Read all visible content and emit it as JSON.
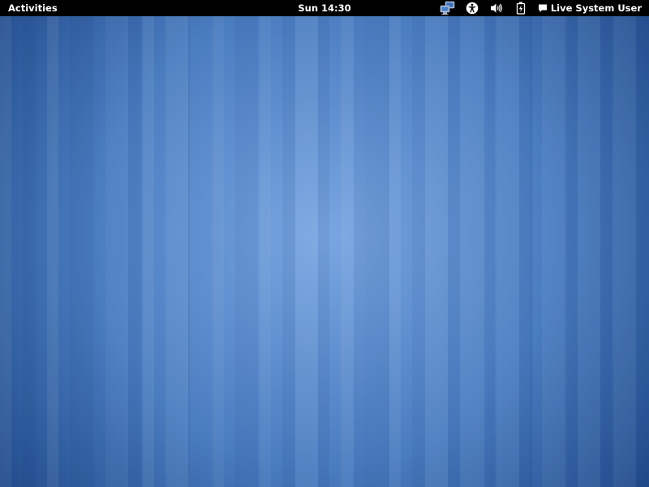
{
  "top_bar": {
    "activities_label": "Activities",
    "clock_text": "Sun 14:30",
    "status_icons": {
      "network": "network-wired-icon",
      "accessibility": "accessibility-icon",
      "volume": "volume-icon",
      "battery": "battery-icon"
    },
    "user": {
      "icon": "chat-bubble-icon",
      "name": "Live System User"
    }
  },
  "desktop": {
    "wallpaper_colors": {
      "center": "#7aa6e2",
      "edge": "#1f4888"
    }
  },
  "colors": {
    "panel_background": "#000000",
    "panel_text": "#ffffff"
  }
}
